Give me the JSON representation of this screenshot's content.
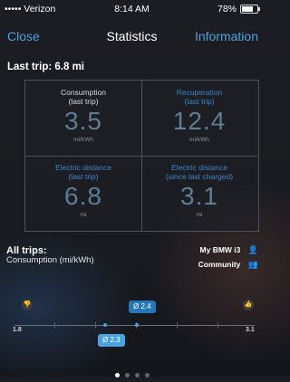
{
  "status_bar": {
    "carrier": "••••• Verizon",
    "time": "8:14 AM",
    "battery": "78%",
    "icons": [
      "wifi-icon",
      "location-icon",
      "bluetooth-icon",
      "battery-icon"
    ]
  },
  "nav": {
    "close": "Close",
    "title": "Statistics",
    "info": "Information"
  },
  "last_trip": {
    "header": "Last trip: 6.8 mi",
    "cells": [
      {
        "label": "Consumption\n(last trip)",
        "value": "3.5",
        "unit": "mi/kWh"
      },
      {
        "label": "Recuperation\n(last trip)",
        "value": "12.4",
        "unit": "mi/kWh"
      },
      {
        "label": "Electric distance\n(last trip)",
        "value": "6.8",
        "unit": "mi"
      },
      {
        "label": "Electric distance\n(since last charged)",
        "value": "3.1",
        "unit": "mi"
      }
    ]
  },
  "all_trips": {
    "header": "All trips:",
    "subtitle": "Consumption (mi/kWh)",
    "legend": [
      {
        "label": "My BMW i3",
        "icon": "person-icon"
      },
      {
        "label": "Community",
        "icon": "group-icon"
      }
    ],
    "scale_min": "1.8",
    "scale_max": "3.1",
    "my_avg": "Ø 2.4",
    "community_avg": "Ø 2.3"
  },
  "pager": {
    "pages": 4,
    "active": 0
  },
  "colors": {
    "accent": "#4aa3df",
    "value": "#5f7c92",
    "background": "#1b1c21"
  }
}
